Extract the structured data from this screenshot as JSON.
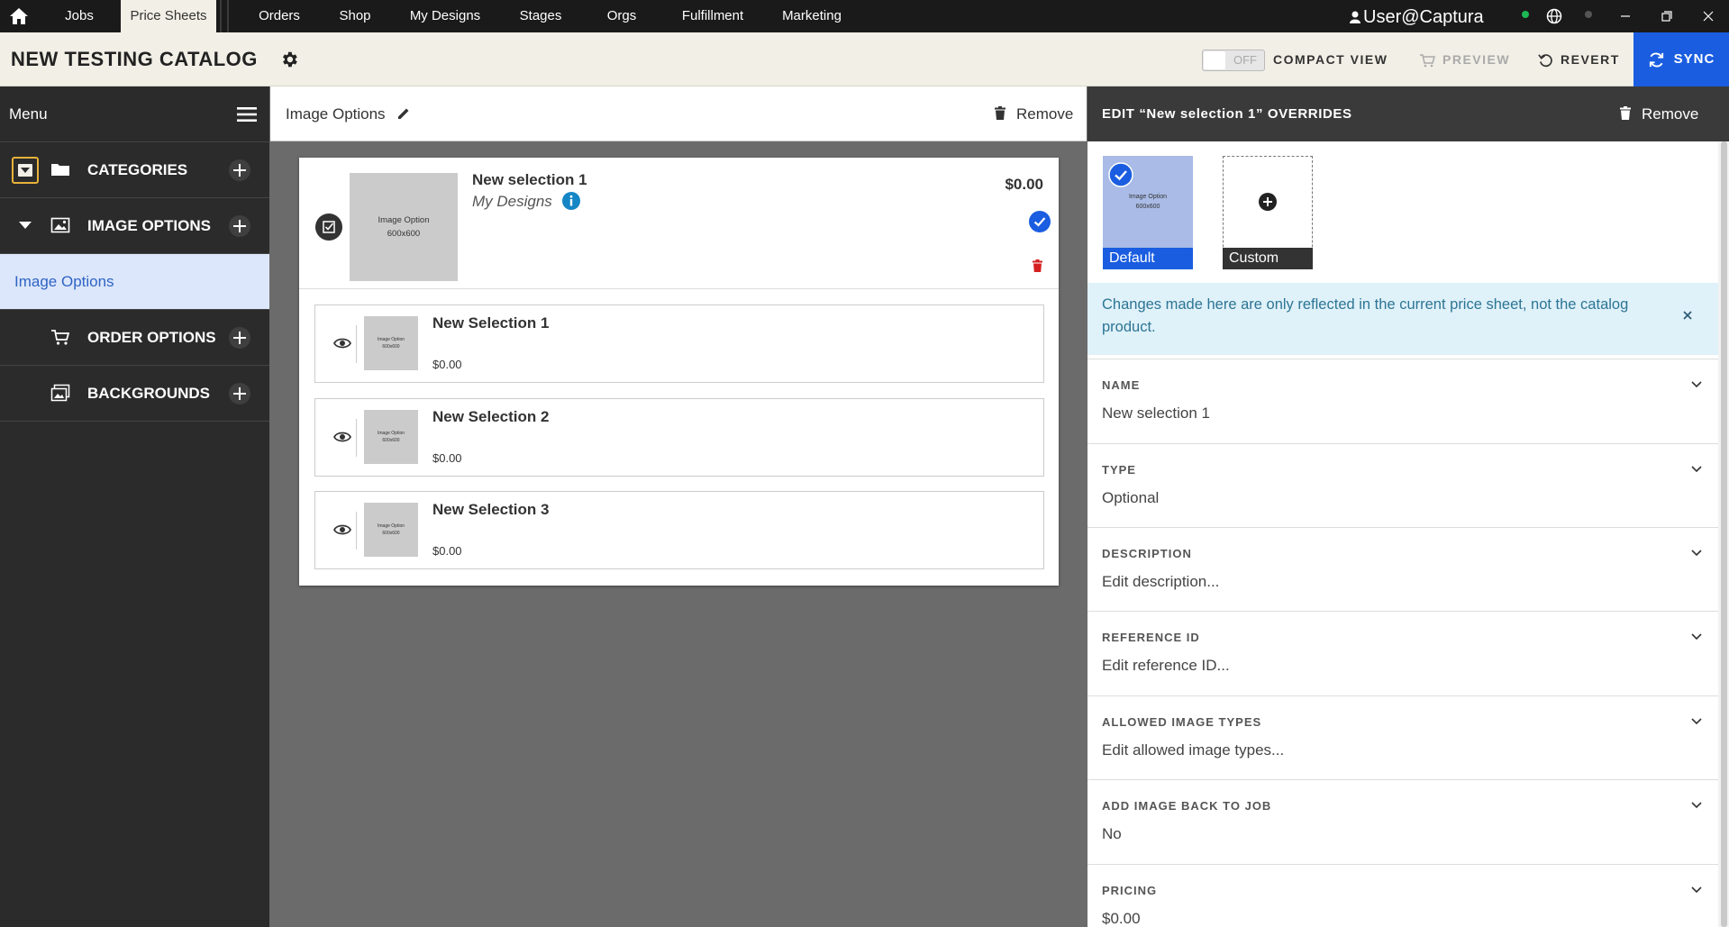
{
  "nav": {
    "tabs": [
      {
        "label": "Jobs"
      },
      {
        "label": "Price Sheets"
      },
      {
        "label": "Orders"
      },
      {
        "label": "Shop"
      },
      {
        "label": "My Designs"
      },
      {
        "label": "Stages"
      },
      {
        "label": "Orgs"
      },
      {
        "label": "Fulfillment"
      },
      {
        "label": "Marketing"
      }
    ],
    "active_tab": "Price Sheets",
    "user": "User@Captura"
  },
  "header": {
    "title": "NEW TESTING CATALOG",
    "compact_toggle_state": "OFF",
    "compact_label": "COMPACT VIEW",
    "preview_label": "PREVIEW",
    "revert_label": "REVERT",
    "sync_label": "SYNC"
  },
  "sidebar": {
    "menu_label": "Menu",
    "sections": [
      {
        "label": "CATEGORIES",
        "icon": "folder-icon"
      },
      {
        "label": "IMAGE OPTIONS",
        "icon": "image-icon"
      },
      {
        "label": "ORDER OPTIONS",
        "icon": "cart-icon"
      },
      {
        "label": "BACKGROUNDS",
        "icon": "background-image-icon"
      }
    ],
    "active_item": "Image Options"
  },
  "center": {
    "title": "Image Options",
    "remove_label": "Remove",
    "option": {
      "name": "New selection 1",
      "subtitle": "My Designs",
      "price": "$0.00",
      "thumb_line1": "Image Option",
      "thumb_line2": "600x600"
    },
    "selections": [
      {
        "name": "New Selection 1",
        "price": "$0.00",
        "thumb_line1": "Image Option",
        "thumb_line2": "600x600"
      },
      {
        "name": "New Selection 2",
        "price": "$0.00",
        "thumb_line1": "Image Option",
        "thumb_line2": "600x600"
      },
      {
        "name": "New Selection 3",
        "price": "$0.00",
        "thumb_line1": "Image Option",
        "thumb_line2": "600x600"
      }
    ]
  },
  "right": {
    "title": "EDIT “New selection 1” OVERRIDES",
    "remove_label": "Remove",
    "image_default_label": "Default",
    "image_custom_label": "Custom",
    "image_thumb_line1": "Image Option",
    "image_thumb_line2": "600x600",
    "notice": "Changes made here are only reflected in the current price sheet, not the catalog product.",
    "fields": [
      {
        "label": "NAME",
        "value": "New selection 1"
      },
      {
        "label": "TYPE",
        "value": "Optional"
      },
      {
        "label": "DESCRIPTION",
        "value": "Edit description..."
      },
      {
        "label": "REFERENCE ID",
        "value": "Edit reference ID..."
      },
      {
        "label": "ALLOWED IMAGE TYPES",
        "value": "Edit allowed image types..."
      },
      {
        "label": "ADD IMAGE BACK TO JOB",
        "value": "No"
      },
      {
        "label": "PRICING",
        "value": "$0.00"
      }
    ]
  },
  "colors": {
    "accent_blue": "#1a5de0",
    "highlight_yellow": "#e8b23a",
    "delete_red": "#d42020",
    "info_blue": "#1486c6"
  }
}
